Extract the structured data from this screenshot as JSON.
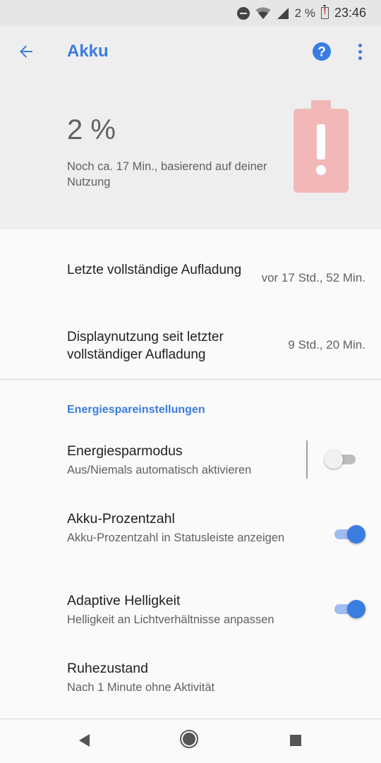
{
  "status_bar": {
    "battery_text": "2 %",
    "time": "23:46",
    "icons": [
      "do-not-disturb-icon",
      "wifi-icon",
      "cell-signal-icon",
      "battery-alert-icon"
    ]
  },
  "app_bar": {
    "title": "Akku",
    "icons": [
      "arrow-back-icon",
      "help-icon",
      "more-vert-icon"
    ]
  },
  "battery_header": {
    "percent": "2 %",
    "remaining": "Noch ca. 17 Min., basierend auf deiner Nutzung",
    "level_fraction": 0.02
  },
  "info": [
    {
      "label": "Letzte vollständige Aufladung",
      "value": "vor 17 Std., 52 Min."
    },
    {
      "label": "Displaynutzung seit letzter vollständiger Aufladung",
      "value": "9 Std., 20 Min."
    }
  ],
  "section_heading": "Energiespareinstellungen",
  "settings": [
    {
      "title": "Energiesparmodus",
      "subtitle": "Aus/Niemals automatisch aktivieren",
      "toggle": false
    },
    {
      "title": "Akku-Prozentzahl",
      "subtitle": "Akku-Prozentzahl in Statusleiste anzeigen",
      "toggle": true
    },
    {
      "title": "Adaptive Helligkeit",
      "subtitle": "Helligkeit an Lichtverhältnisse anpassen",
      "toggle": true
    },
    {
      "title": "Ruhezustand",
      "subtitle": "Nach 1 Minute ohne Aktivität"
    }
  ],
  "colors": {
    "accent": "#3b7ce0",
    "battery_alert": "#f2b8b8",
    "header_bg": "#eeeeee"
  }
}
